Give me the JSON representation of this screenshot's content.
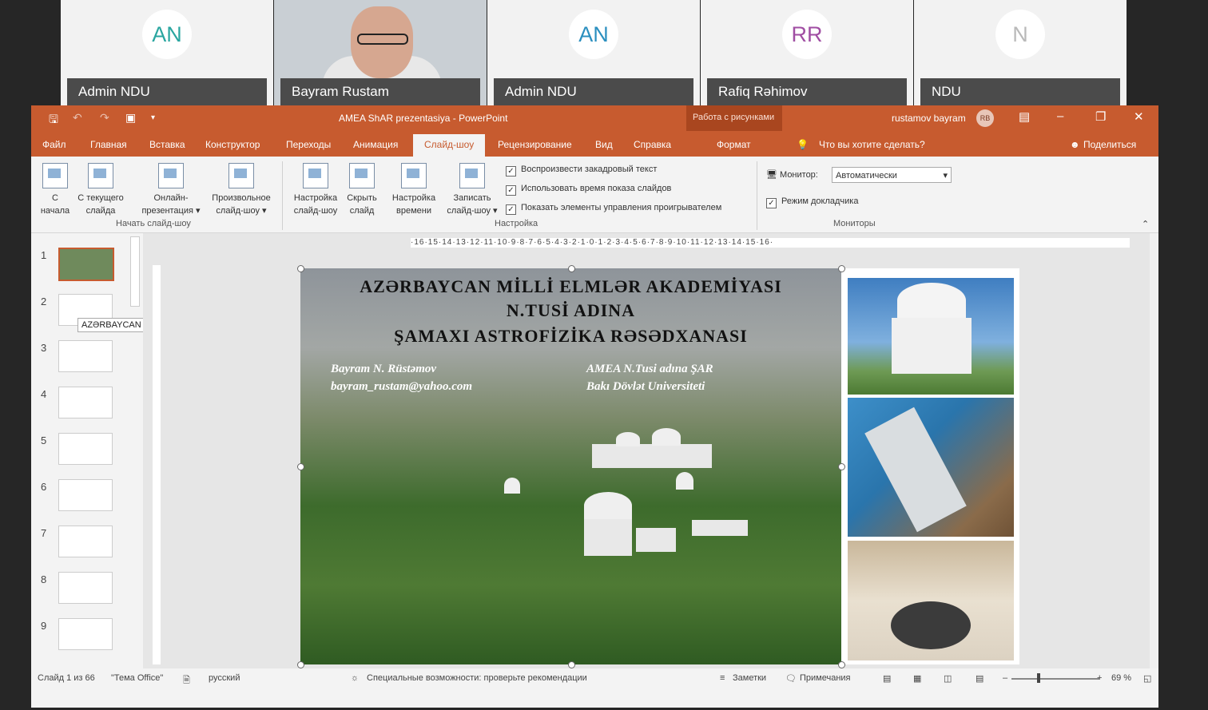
{
  "participants": [
    {
      "initials": "AN",
      "name": "Admin NDU",
      "color": "#2aa6a0"
    },
    {
      "initials": "",
      "name": "Bayram Rustam",
      "video": true
    },
    {
      "initials": "AN",
      "name": "Admin NDU",
      "color": "#2b8fbf"
    },
    {
      "initials": "RR",
      "name": "Rafiq Rəhimov",
      "color": "#a04ea3"
    },
    {
      "initials": "N",
      "name": "NDU",
      "color": "#b9b9b9"
    }
  ],
  "window": {
    "title": "AMEA ShAR prezentasiya - PowerPoint",
    "context_group": "Работа с рисунками",
    "user": "rustamov bayram",
    "user_initials": "RB"
  },
  "tabs": [
    "Файл",
    "Главная",
    "Вставка",
    "Конструктор",
    "Переходы",
    "Анимация",
    "Слайд-шоу",
    "Рецензирование",
    "Вид",
    "Справка",
    "Формат"
  ],
  "active_tab": "Слайд-шоу",
  "tell_me": "Что вы хотите сделать?",
  "share": "Поделиться",
  "ribbon": {
    "start_group": "Начать слайд-шоу",
    "setup_group": "Настройка",
    "monitors_group": "Мониторы",
    "btn_from_start": [
      "С",
      "начала"
    ],
    "btn_from_current": [
      "С текущего",
      "слайда"
    ],
    "btn_online": [
      "Онлайн-",
      "презентация ▾"
    ],
    "btn_custom": [
      "Произвольное",
      "слайд-шоу ▾"
    ],
    "btn_setup": [
      "Настройка",
      "слайд-шоу"
    ],
    "btn_hide": [
      "Скрыть",
      "слайд"
    ],
    "btn_timing": [
      "Настройка",
      "времени"
    ],
    "btn_record": [
      "Записать",
      "слайд-шоу ▾"
    ],
    "chk_narration": "Воспроизвести закадровый текст",
    "chk_timings": "Использовать время показа слайдов",
    "chk_media": "Показать элементы управления проигрывателем",
    "monitor_label": "Монитор:",
    "monitor_value": "Автоматически",
    "presenter_view": "Режим докладчика"
  },
  "thumbnails": [
    "1",
    "2",
    "3",
    "4",
    "5",
    "6",
    "7",
    "8",
    "9"
  ],
  "tooltip": "AZƏRBAYCAN RESPUBLİKASI",
  "ruler": "·16·15·14·13·12·11·10·9·8·7·6·5·4·3·2·1·0·1·2·3·4·5·6·7·8·9·10·11·12·13·14·15·16·",
  "slide": {
    "title1": "AZƏRBAYCAN  MİLLİ  ELMLƏR AKADEMİYASI",
    "title2": "N.TUSİ ADINA",
    "title3": "ŞAMAXI   ASTROFİZİKA  RƏSƏDXANASI",
    "author": "Bayram N. Rüstəmov",
    "email": "bayram_rustam@yahoo.com",
    "org1": "AMEA N.Tusi adına ŞAR",
    "org2": "Bakı Dövlət Universiteti"
  },
  "status": {
    "slide_of": "Слайд 1 из 66",
    "theme": "\"Тема Office\"",
    "lang": "русский",
    "accessibility": "Специальные возможности: проверьте рекомендации",
    "notes": "Заметки",
    "comments": "Примечания",
    "zoom": "69 %"
  }
}
